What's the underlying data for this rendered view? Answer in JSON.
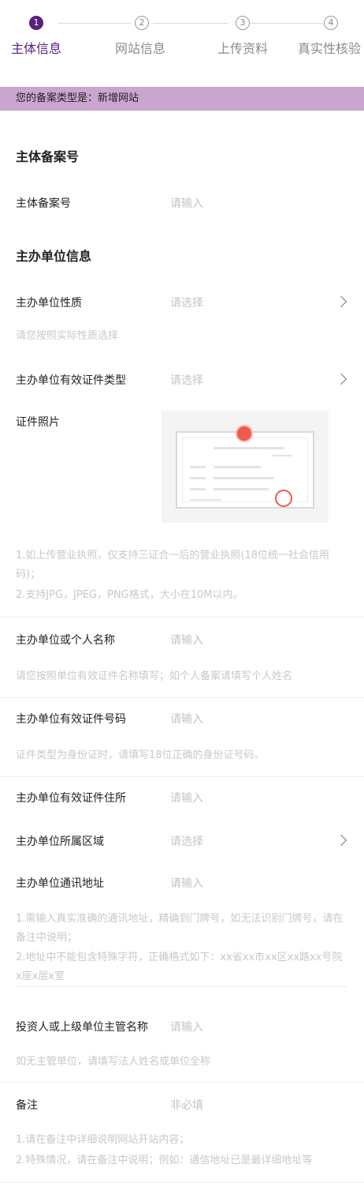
{
  "stepper": {
    "steps": [
      {
        "num": "1",
        "label": "主体信息"
      },
      {
        "num": "2",
        "label": "网站信息"
      },
      {
        "num": "3",
        "label": "上传资料"
      },
      {
        "num": "4",
        "label": "真实性核验"
      }
    ]
  },
  "notice": "您的备案类型是：新增网站",
  "sections": {
    "record": "主体备案号",
    "sponsor": "主办单位信息"
  },
  "fields": {
    "record_no": {
      "label": "主体备案号",
      "placeholder": "请输入"
    },
    "nature": {
      "label": "主办单位性质",
      "placeholder": "请选择",
      "hint": "请您按照实际性质选择"
    },
    "cert_type": {
      "label": "主办单位有效证件类型",
      "placeholder": "请选择"
    },
    "cert_photo": {
      "label": "证件照片",
      "hint1": "1.如上传营业执照，仅支持三证合一后的营业执照(18位统一社会信用码)；",
      "hint2": "2.支持JPG，JPEG，PNG格式，大小在10M以内。"
    },
    "name": {
      "label": "主办单位或个人名称",
      "placeholder": "请输入",
      "hint": "请您按照单位有效证件名称填写；如个人备案请填写个人姓名"
    },
    "cert_no": {
      "label": "主办单位有效证件号码",
      "placeholder": "请输入",
      "hint": "证件类型为身份证时，请填写18位正确的身份证号码。"
    },
    "cert_addr": {
      "label": "主办单位有效证件住所",
      "placeholder": "请输入"
    },
    "region": {
      "label": "主办单位所属区域",
      "placeholder": "请选择"
    },
    "mail_addr": {
      "label": "主办单位通讯地址",
      "placeholder": "请输入",
      "hint1": "1.需输入真实准确的通讯地址，精确到门牌号，如无法识别门牌号，请在备注中说明；",
      "hint2": "2.地址中不能包含特殊字符，正确格式如下：xx省xx市xx区xx路xx号院x座x层x室"
    },
    "investor": {
      "label": "投资人或上级单位主管名称",
      "placeholder": "请输入",
      "hint": "如无主管单位，请填写法人姓名或单位全称"
    },
    "remark": {
      "label": "备注",
      "placeholder": "非必填",
      "hint1": "1.请在备注中详细说明网站开站内容；",
      "hint2": "2.特殊情况，请在备注中说明；例如：通信地址已是最详细地址等"
    }
  },
  "colors": {
    "accent": "#5b1f7e",
    "notice_bg": "#c9a5cf",
    "placeholder": "#c4c4c4"
  }
}
